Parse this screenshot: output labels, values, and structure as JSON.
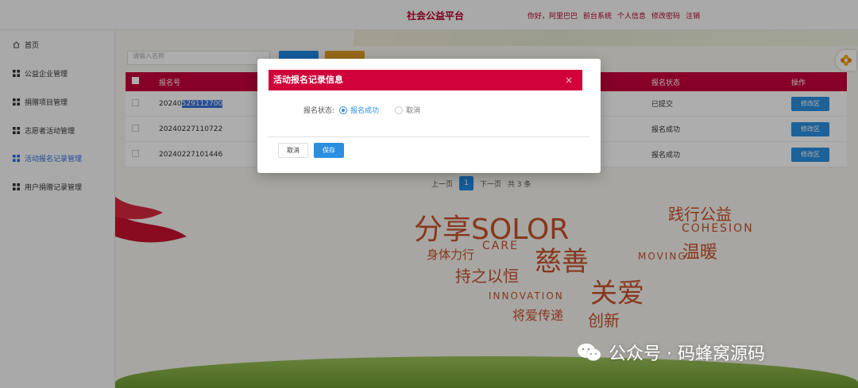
{
  "header": {
    "site_title": "社会公益平台",
    "nav": [
      "你好，阿里巴巴",
      "前台系统",
      "个人信息",
      "修改密码",
      "注销"
    ]
  },
  "sidebar": {
    "items": [
      {
        "label": "首页",
        "icon": "home-icon"
      },
      {
        "label": "公益企业管理",
        "icon": "grid-icon"
      },
      {
        "label": "捐赠项目管理",
        "icon": "grid-icon"
      },
      {
        "label": "志愿者活动管理",
        "icon": "grid-icon"
      },
      {
        "label": "活动报名记录管理",
        "icon": "grid-icon",
        "active": true
      },
      {
        "label": "用户捐赠记录管理",
        "icon": "grid-icon"
      }
    ]
  },
  "toolbar": {
    "search_placeholder": "请输入名称"
  },
  "table": {
    "headers": {
      "no": "报名号",
      "status": "报名状态",
      "op": "操作"
    },
    "rows": [
      {
        "no_prefix": "20240",
        "no_selected": "529112700",
        "status": "已提交",
        "edit": "修改区"
      },
      {
        "no_prefix": "20240227110722",
        "no_selected": "",
        "status": "报名成功",
        "edit": "修改区"
      },
      {
        "no_prefix": "20240227101446",
        "no_selected": "",
        "status": "报名成功",
        "edit": "修改区"
      }
    ]
  },
  "pager": {
    "prev": "上一页",
    "page": "1",
    "next": "下一页",
    "total": "共 3 条"
  },
  "background_words": [
    "分享SOLOR",
    "慈善",
    "关爱",
    "温暖",
    "COHESION",
    "CARE",
    "INNOVATION",
    "身体力行",
    "持之以恒",
    "将爱传递",
    "创新",
    "MOVING",
    "践行公益"
  ],
  "watermark": "公众号 · 码蜂窝源码",
  "modal": {
    "title": "活动报名记录信息",
    "close": "×",
    "field_label": "报名状态:",
    "options": [
      {
        "label": "报名成功",
        "checked": true
      },
      {
        "label": "取消",
        "checked": false
      }
    ],
    "cancel": "取消",
    "save": "保存"
  },
  "colors": {
    "brand_red": "#d0003a",
    "primary_blue": "#2a8fe0"
  }
}
